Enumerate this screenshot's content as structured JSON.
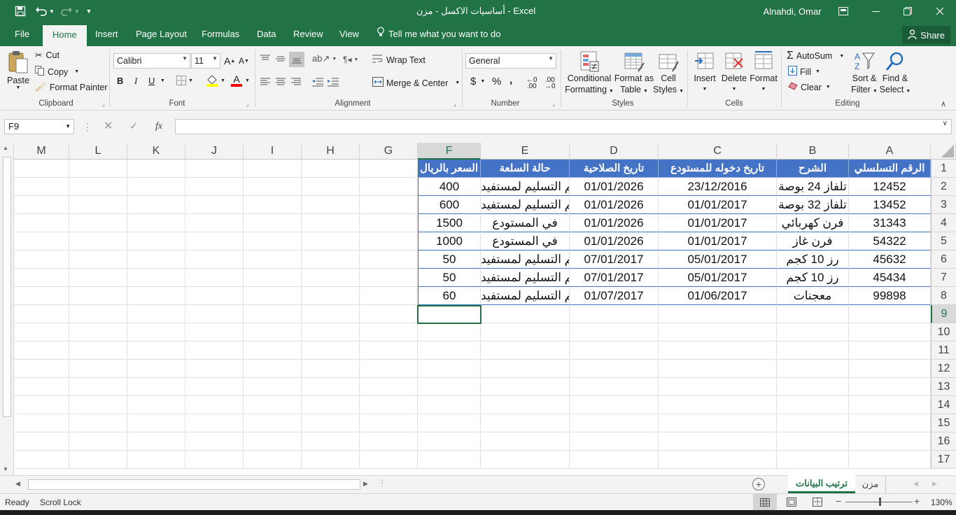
{
  "window": {
    "title": "أساسيات الاكسل - مزن - Excel",
    "user": "Alnahdi, Omar"
  },
  "tabs": [
    "File",
    "Home",
    "Insert",
    "Page Layout",
    "Formulas",
    "Data",
    "Review",
    "View"
  ],
  "tell_me": "Tell me what you want to do",
  "share": "Share",
  "ribbon": {
    "clipboard": {
      "paste": "Paste",
      "cut": "Cut",
      "copy": "Copy",
      "format_painter": "Format Painter",
      "label": "Clipboard"
    },
    "font": {
      "name": "Calibri",
      "size": "11",
      "label": "Font",
      "bold": "B",
      "italic": "I",
      "underline": "U"
    },
    "alignment": {
      "wrap": "Wrap Text",
      "merge": "Merge & Center",
      "label": "Alignment"
    },
    "number": {
      "format": "General",
      "label": "Number",
      "currency": "$",
      "percent": "%",
      "comma": ","
    },
    "styles": {
      "conditional": "Conditional",
      "conditional2": "Formatting",
      "format_as": "Format as",
      "format_as2": "Table",
      "cell": "Cell",
      "cell2": "Styles",
      "label": "Styles"
    },
    "cells": {
      "insert": "Insert",
      "delete": "Delete",
      "format": "Format",
      "label": "Cells"
    },
    "editing": {
      "autosum": "AutoSum",
      "fill": "Fill",
      "clear": "Clear",
      "sort": "Sort &",
      "sort2": "Filter",
      "find": "Find &",
      "find2": "Select",
      "label": "Editing"
    }
  },
  "formula_bar": {
    "name_box": "F9",
    "fx": "fx",
    "value": ""
  },
  "columns": [
    "M",
    "L",
    "K",
    "J",
    "I",
    "H",
    "G",
    "F",
    "E",
    "D",
    "C",
    "B",
    "A"
  ],
  "rows": [
    "1",
    "2",
    "3",
    "4",
    "5",
    "6",
    "7",
    "8",
    "9",
    "10",
    "11",
    "12",
    "13",
    "14",
    "15",
    "16",
    "17"
  ],
  "table": {
    "headers": [
      "الرقم التسلسلي",
      "الشرح",
      "تاريخ دخوله للمستودع",
      "تاريخ الصلاحية",
      "حالة السلعة",
      "السعر بالريال"
    ],
    "data": [
      [
        "12452",
        "تلفاز 24 بوصة",
        "23/12/2016",
        "01/01/2026",
        "تم التسليم لمستفيد",
        "400"
      ],
      [
        "13452",
        "تلفاز 32 بوصة",
        "01/01/2017",
        "01/01/2026",
        "تم التسليم لمستفيد",
        "600"
      ],
      [
        "31343",
        "فرن كهربائي",
        "01/01/2017",
        "01/01/2026",
        "في المستودع",
        "1500"
      ],
      [
        "54322",
        "فرن غاز",
        "01/01/2017",
        "01/01/2026",
        "في المستودع",
        "1000"
      ],
      [
        "45632",
        "رز 10 كجم",
        "05/01/2017",
        "07/01/2017",
        "تم التسليم لمستفيد",
        "50"
      ],
      [
        "45434",
        "رز 10 كجم",
        "05/01/2017",
        "07/01/2017",
        "تم التسليم لمستفيد",
        "50"
      ],
      [
        "99898",
        "معجنات",
        "01/06/2017",
        "01/07/2017",
        "تم التسليم لمستفيد",
        "60"
      ]
    ]
  },
  "sheets": [
    "ترتيب البيانات",
    "مزن"
  ],
  "status": {
    "ready": "Ready",
    "scroll_lock": "Scroll Lock",
    "zoom": "130%"
  },
  "colors": {
    "excel_green": "#217346",
    "table_header": "#4472c4"
  }
}
